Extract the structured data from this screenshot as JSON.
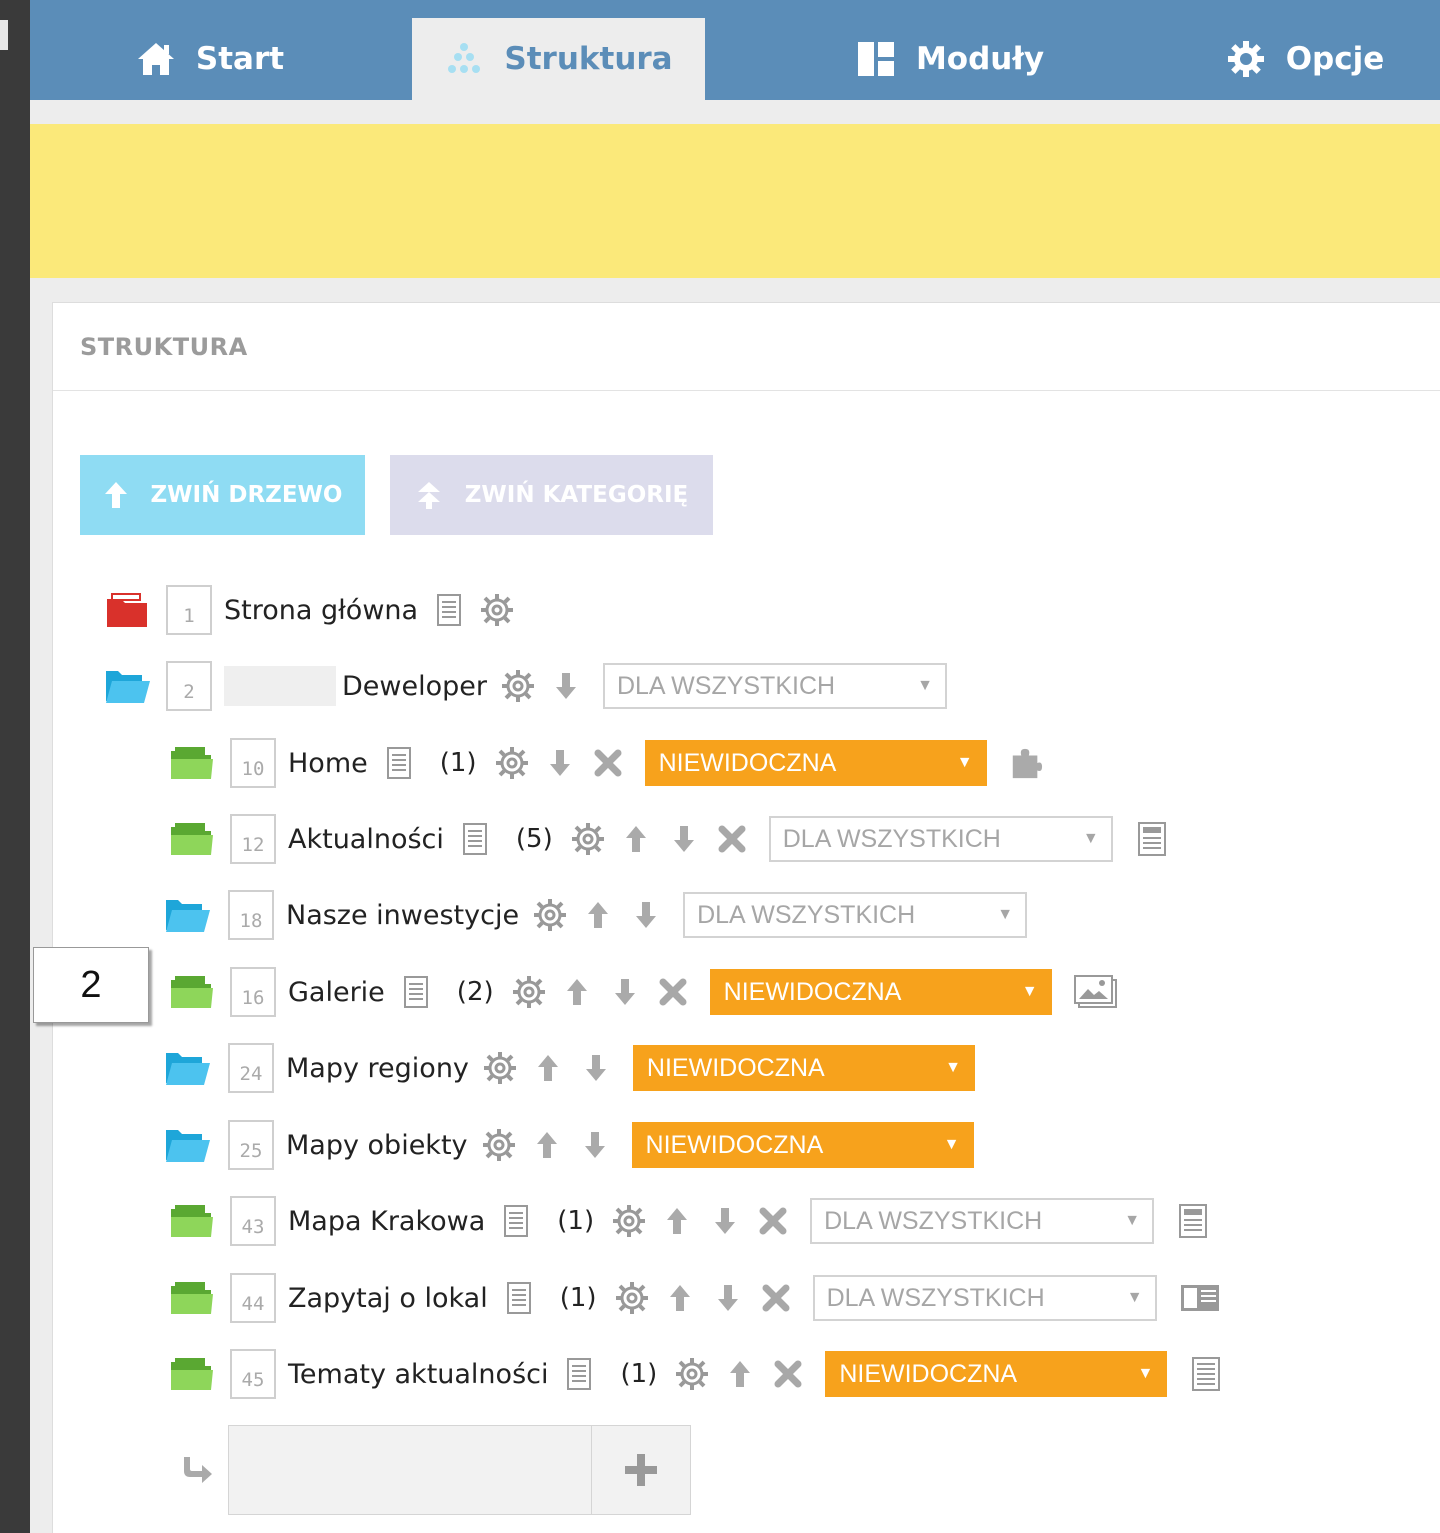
{
  "nav": {
    "tabs": [
      {
        "label": "Start",
        "icon": "home-icon"
      },
      {
        "label": "Struktura",
        "icon": "structure-icon",
        "active": true
      },
      {
        "label": "Moduły",
        "icon": "modules-icon"
      },
      {
        "label": "Opcje",
        "icon": "gear-icon"
      }
    ]
  },
  "panel": {
    "title": "STRUKTURA"
  },
  "buttons": {
    "collapse_tree": "ZWIŃ DRZEWO",
    "collapse_category": "ZWIŃ KATEGORIĘ"
  },
  "tree": {
    "root": {
      "id": "1",
      "name": "Strona główna"
    },
    "parent": {
      "id": "2",
      "name": "Deweloper",
      "access": "DLA WSZYSTKICH"
    },
    "children": [
      {
        "id": "10",
        "name": "Home",
        "count": "(1)",
        "access": "NIEWIDOCZNA"
      },
      {
        "id": "12",
        "name": "Aktualności",
        "count": "(5)",
        "access": "DLA WSZYSTKICH"
      },
      {
        "id": "18",
        "name": "Nasze inwestycje",
        "access": "DLA WSZYSTKICH"
      },
      {
        "id": "16",
        "name": "Galerie",
        "count": "(2)",
        "access": "NIEWIDOCZNA"
      },
      {
        "id": "24",
        "name": "Mapy regiony",
        "access": "NIEWIDOCZNA"
      },
      {
        "id": "25",
        "name": "Mapy obiekty",
        "access": "NIEWIDOCZNA"
      },
      {
        "id": "43",
        "name": "Mapa Krakowa",
        "count": "(1)",
        "access": "DLA WSZYSTKICH"
      },
      {
        "id": "44",
        "name": "Zapytaj o lokal",
        "count": "(1)",
        "access": "DLA WSZYSTKICH"
      },
      {
        "id": "45",
        "name": "Tematy aktualności",
        "count": "(1)",
        "access": "NIEWIDOCZNA"
      }
    ]
  },
  "callout": {
    "label": "2"
  },
  "colors": {
    "nav": "#5b8db8",
    "yellow": "#fbe97a",
    "orange": "#f7a21c",
    "green_folder": "#7cc84a",
    "blue_folder": "#33b5e5",
    "red_folder": "#d9312b"
  }
}
